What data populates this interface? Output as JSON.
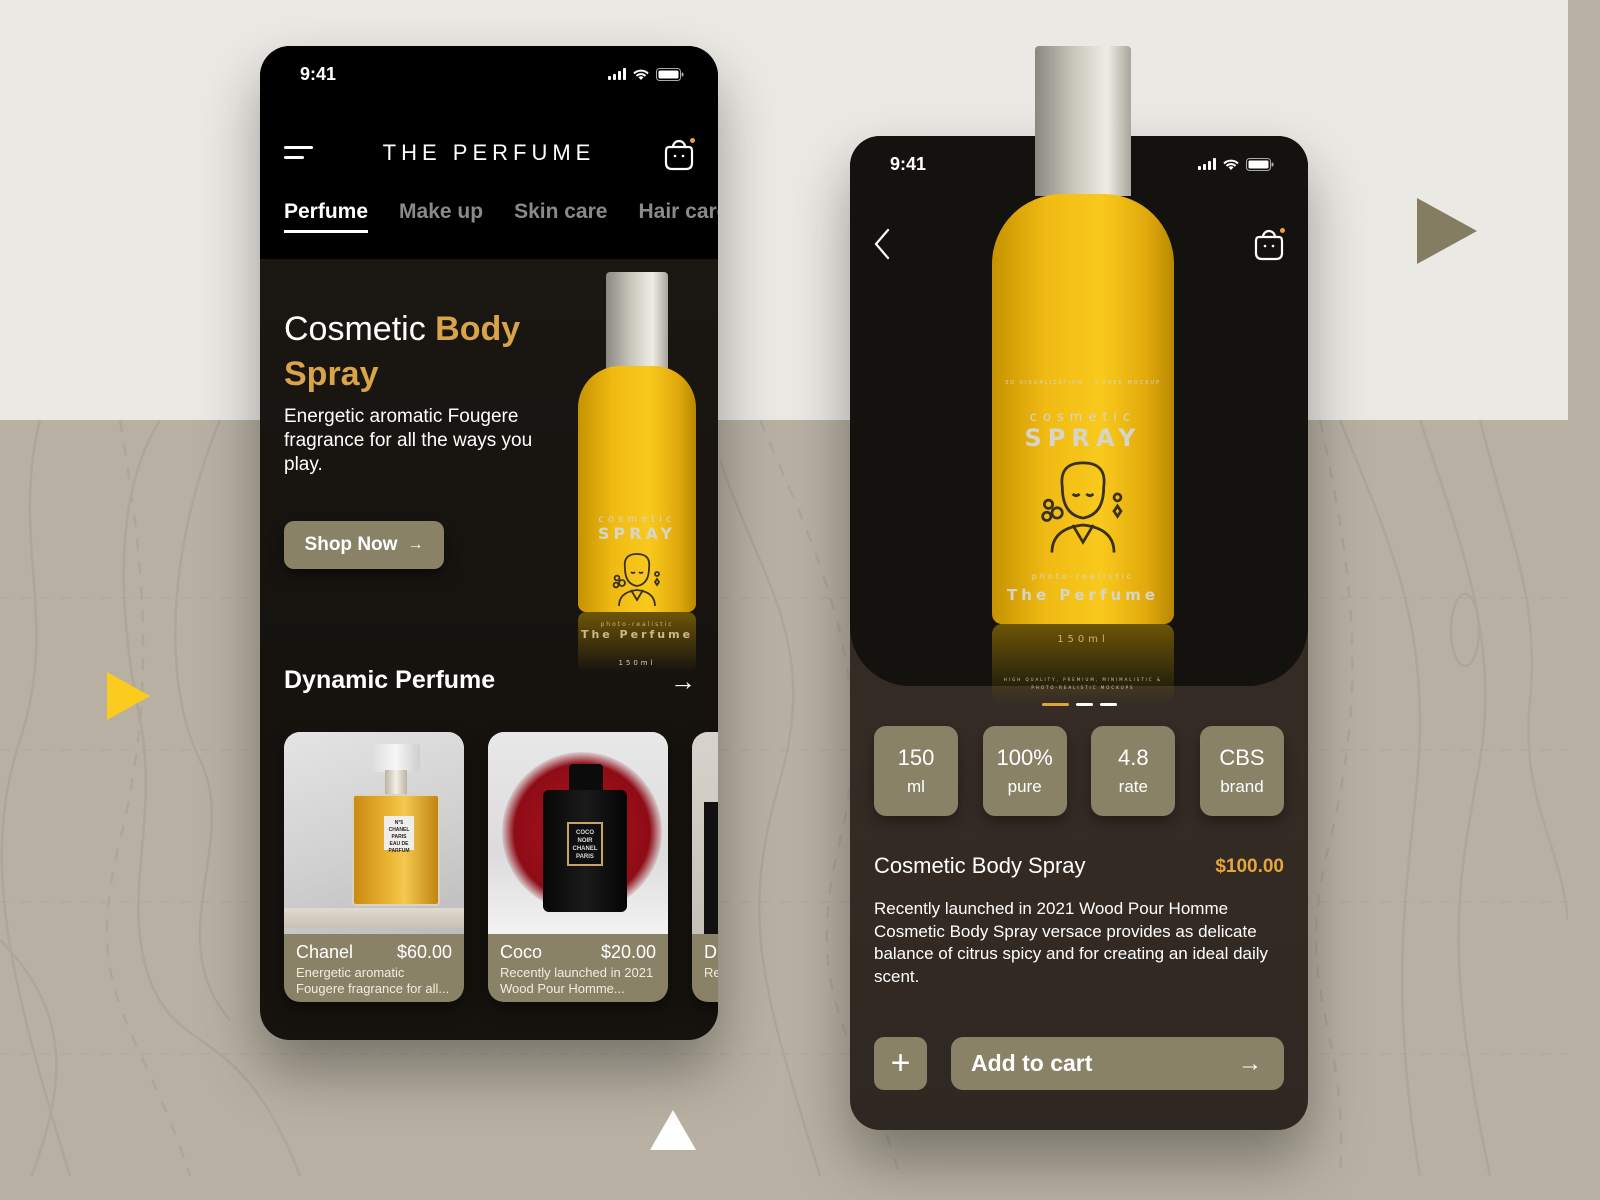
{
  "screens": {
    "home": {
      "status_bar": {
        "time": "9:41"
      },
      "header": {
        "title": "THE PERFUME",
        "menu_icon": "hamburger-menu-icon",
        "cart_icon": "shopping-bag-icon"
      },
      "tabs": [
        {
          "label": "Perfume",
          "active": true
        },
        {
          "label": "Make up",
          "active": false
        },
        {
          "label": "Skin care",
          "active": false
        },
        {
          "label": "Hair care",
          "active": false
        }
      ],
      "hero": {
        "title_light": "Cosmetic ",
        "title_bold": "Body Spray",
        "description": "Energetic aromatic Fougere fragrance for all the ways you play.",
        "button_label": "Shop Now",
        "button_icon": "arrow-right-icon",
        "bottle_label": {
          "line1": "cosmetic",
          "line2": "SPRAY",
          "line3": "photo-realistic",
          "line4": "The Perfume",
          "line5": "150ml"
        }
      },
      "section": {
        "title": "Dynamic Perfume",
        "arrow_icon": "arrow-right-icon"
      },
      "products": [
        {
          "name": "Chanel",
          "price": "$60.00",
          "description": "Energetic aromatic Fougere fragrance for all...",
          "image_label": [
            "N°5",
            "CHANEL",
            "PARIS",
            "EAU DE PARFUM"
          ]
        },
        {
          "name": "Coco",
          "price": "$20.00",
          "description": "Recently launched in 2021 Wood Pour Homme...",
          "image_label": [
            "COCO",
            "NOIR",
            "CHANEL",
            "PARIS"
          ]
        },
        {
          "name": "D",
          "price": "",
          "description": "Re W"
        }
      ]
    },
    "detail": {
      "status_bar": {
        "time": "9:41"
      },
      "back_icon": "chevron-left-icon",
      "cart_icon": "shopping-bag-icon",
      "bottle_label": {
        "line0": "3D VISUALIZATION · 3 FREE MOCKUP",
        "line1": "cosmetic",
        "line2": "SPRAY",
        "line3": "photo-realistic",
        "line4": "The Perfume",
        "line5": "150ml",
        "line6": "HIGH QUALITY, PREMIUM, MINIMALISTIC & PHOTO-REALISTIC MOCKUPS"
      },
      "carousel": {
        "count": 3,
        "active_index": 0
      },
      "specs": [
        {
          "value": "150",
          "label": "ml"
        },
        {
          "value": "100%",
          "label": "pure"
        },
        {
          "value": "4.8",
          "label": "rate"
        },
        {
          "value": "CBS",
          "label": "brand"
        }
      ],
      "product": {
        "name": "Cosmetic Body Spray",
        "price": "$100.00",
        "description": "Recently launched in 2021 Wood Pour Homme Cosmetic Body Spray versace provides as delicate balance of citrus spicy and for creating an ideal daily scent."
      },
      "actions": {
        "plus_label": "+",
        "add_to_cart_label": "Add to cart",
        "arrow": "→"
      }
    }
  },
  "colors": {
    "accent_gold": "#d8a349",
    "price_gold": "#e4a63b",
    "olive_button": "#8a8266",
    "bottle_yellow": "#f9c91c",
    "bg_light": "#ebe9e4",
    "bg_taupe": "#b8b1a3",
    "deco_yellow": "#fbcb1e",
    "deco_olive": "#857d62"
  }
}
